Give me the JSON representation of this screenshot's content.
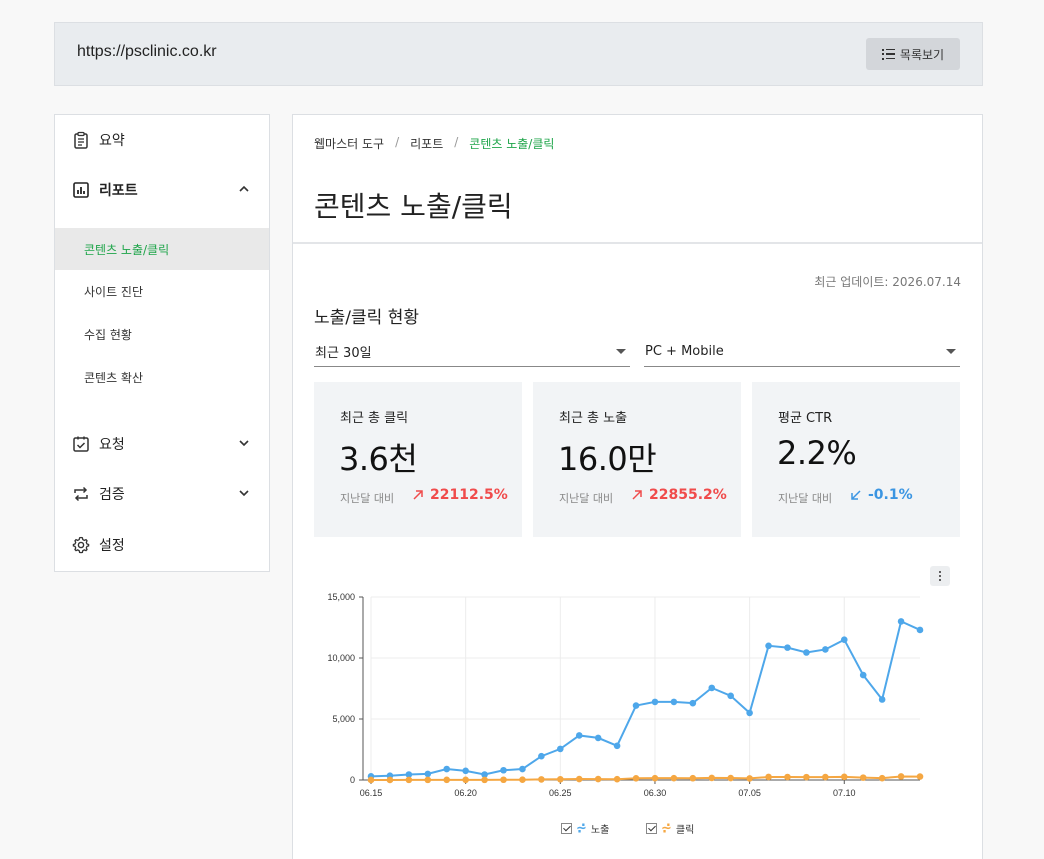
{
  "browser": {
    "url": "https://psclinic.co.kr",
    "list_button": "목록보기"
  },
  "sidebar": {
    "summary": "요약",
    "report": "리포트",
    "report_sub": [
      "콘텐츠 노출/클릭",
      "사이트 진단",
      "수집 현황",
      "콘텐츠 확산"
    ],
    "request": "요청",
    "verify": "검증",
    "settings": "설정"
  },
  "breadcrumb": {
    "root": "웹마스터 도구",
    "sep": "/",
    "parent": "리포트",
    "current": "콘텐츠 노출/클릭"
  },
  "page": {
    "title": "콘텐츠 노출/클릭",
    "updated": "최근 업데이트: 2026.07.14",
    "section_title": "노출/클릭 현황",
    "period_select": "최근 30일",
    "device_select": "PC + Mobile"
  },
  "cards": [
    {
      "label": "최근 총 클릭",
      "value": "3.6천",
      "compare": "지난달 대비",
      "change": "22112.5%",
      "direction": "up"
    },
    {
      "label": "최근 총 노출",
      "value": "16.0만",
      "compare": "지난달 대비",
      "change": "22855.2%",
      "direction": "up"
    },
    {
      "label": "평균 CTR",
      "value": "2.2%",
      "compare": "지난달 대비",
      "change": "-0.1%",
      "direction": "down"
    }
  ],
  "colors": {
    "accent_green": "#1fa54a",
    "up": "#f04b4b",
    "down": "#3b95e2",
    "impressions": "#4ea7ea",
    "clicks": "#f5a742"
  },
  "chart_data": {
    "type": "line",
    "x": [
      "06.15",
      "06.16",
      "06.17",
      "06.18",
      "06.19",
      "06.20",
      "06.21",
      "06.22",
      "06.23",
      "06.24",
      "06.25",
      "06.26",
      "06.27",
      "06.28",
      "06.29",
      "06.30",
      "07.01",
      "07.02",
      "07.03",
      "07.04",
      "07.05",
      "07.06",
      "07.07",
      "07.08",
      "07.09",
      "07.10",
      "07.11",
      "07.12",
      "07.13",
      "07.14"
    ],
    "xticks": [
      "06.15",
      "06.20",
      "06.25",
      "06.30",
      "07.05",
      "07.10"
    ],
    "yticks": [
      "0",
      "5,000",
      "10,000",
      "15,000"
    ],
    "ylim": [
      0,
      15000
    ],
    "grid": true,
    "legend_position": "bottom",
    "series": [
      {
        "name": "노출",
        "values": [
          300,
          350,
          450,
          500,
          900,
          750,
          450,
          800,
          900,
          1950,
          2550,
          3650,
          3450,
          2800,
          6100,
          6400,
          6400,
          6300,
          7550,
          6900,
          5500,
          11000,
          10850,
          10450,
          10700,
          11500,
          8600,
          6600,
          13000,
          12300
        ]
      },
      {
        "name": "클릭",
        "values": [
          5,
          5,
          10,
          10,
          15,
          15,
          10,
          20,
          25,
          50,
          60,
          80,
          75,
          65,
          140,
          150,
          150,
          145,
          170,
          160,
          130,
          250,
          245,
          235,
          240,
          260,
          195,
          150,
          290,
          280
        ]
      }
    ]
  }
}
